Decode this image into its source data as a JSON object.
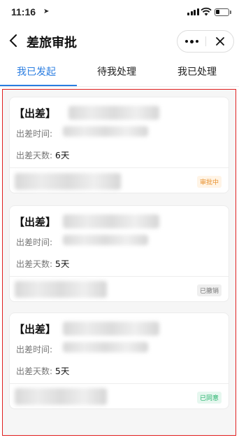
{
  "status_bar": {
    "time": "11:16"
  },
  "nav": {
    "title": "差旅审批",
    "more_label": "•••"
  },
  "tabs": [
    {
      "label": "我已发起",
      "active": true
    },
    {
      "label": "待我处理",
      "active": false
    },
    {
      "label": "我已处理",
      "active": false
    }
  ],
  "field_labels": {
    "time": "出差时间:",
    "days": "出差天数:"
  },
  "cards": [
    {
      "type": "【出差】",
      "days": "6天",
      "status": "审批中"
    },
    {
      "type": "【出差】",
      "days": "5天",
      "status": "已撤销"
    },
    {
      "type": "【出差】",
      "days": "5天",
      "status": "已同意"
    }
  ],
  "colors": {
    "accent": "#2a7de1",
    "highlight_border": "#e02020",
    "pending": "#e8912d",
    "cancelled": "#777777",
    "approved": "#23b26a"
  }
}
